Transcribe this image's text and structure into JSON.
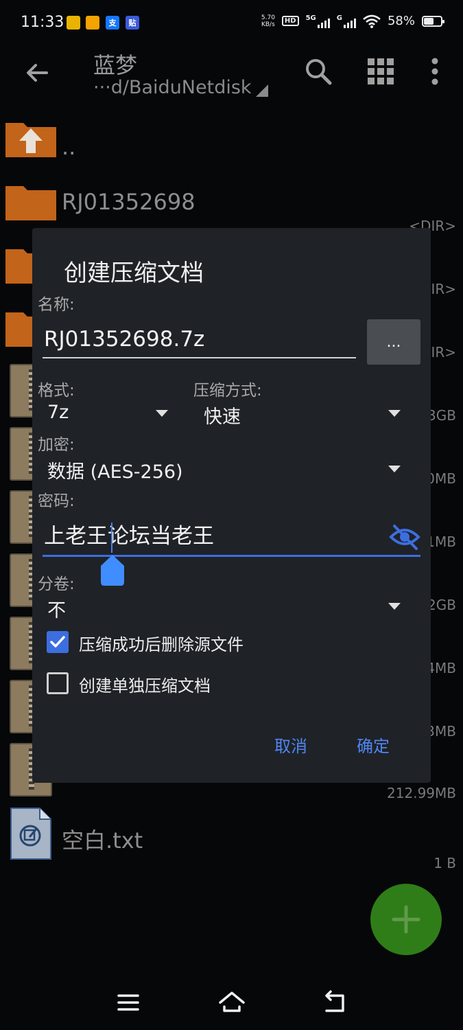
{
  "status_bar": {
    "time": "11:33",
    "net_speed_value": "5.70",
    "net_speed_unit": "KB/s",
    "hd": "HD",
    "sim1": "5G",
    "sim2": "G",
    "battery": "58%",
    "battery_level": 0.58,
    "notification_icons": [
      "shop-app-icon",
      "gallery-app-icon",
      "alipay-icon",
      "tieba-icon"
    ],
    "notification_labels": [
      "",
      "",
      "支",
      "贴"
    ]
  },
  "app_bar": {
    "title": "蓝梦",
    "path": "···d/BaiduNetdisk"
  },
  "file_list": [
    {
      "name": "..",
      "type": "parent-folder",
      "size": ""
    },
    {
      "name": "RJ01352698",
      "type": "folder",
      "size": "<DIR>"
    },
    {
      "name": "",
      "type": "folder",
      "size": "DIR>"
    },
    {
      "name": "",
      "type": "folder",
      "size": "DIR>"
    },
    {
      "name": "",
      "type": "archive",
      "size": "3GB"
    },
    {
      "name": "",
      "type": "archive",
      "size": "0MB"
    },
    {
      "name": "",
      "type": "archive",
      "size": "1MB"
    },
    {
      "name": "",
      "type": "archive",
      "size": "2GB"
    },
    {
      "name": "",
      "type": "archive",
      "size": "4MB"
    },
    {
      "name": "",
      "type": "archive",
      "size": "3MB"
    },
    {
      "name": "",
      "type": "archive",
      "size": "212.99MB"
    },
    {
      "name": "空白.txt",
      "type": "text",
      "size": "1 B"
    }
  ],
  "dialog": {
    "title": "创建压缩文档",
    "name_label": "名称:",
    "name_value": "RJ01352698.7z",
    "browse_label": "...",
    "format_label": "格式:",
    "format_value": "7z",
    "method_label": "压缩方式:",
    "method_value": "快速",
    "encryption_label": "加密:",
    "encryption_value": "数据 (AES-256)",
    "password_label": "密码:",
    "password_value": "上老王论坛当老王",
    "split_label": "分卷:",
    "split_value": "不",
    "checkbox_delete_label": "压缩成功后删除源文件",
    "checkbox_delete_checked": true,
    "checkbox_separate_label": "创建单独压缩文档",
    "checkbox_separate_checked": false,
    "cancel_label": "取消",
    "ok_label": "确定"
  },
  "colors": {
    "accent": "#3d6ee0",
    "button_text": "#4f86f2",
    "fab": "#2f7d18",
    "folder": "#c2641a",
    "dialog_bg": "#1f2227"
  }
}
